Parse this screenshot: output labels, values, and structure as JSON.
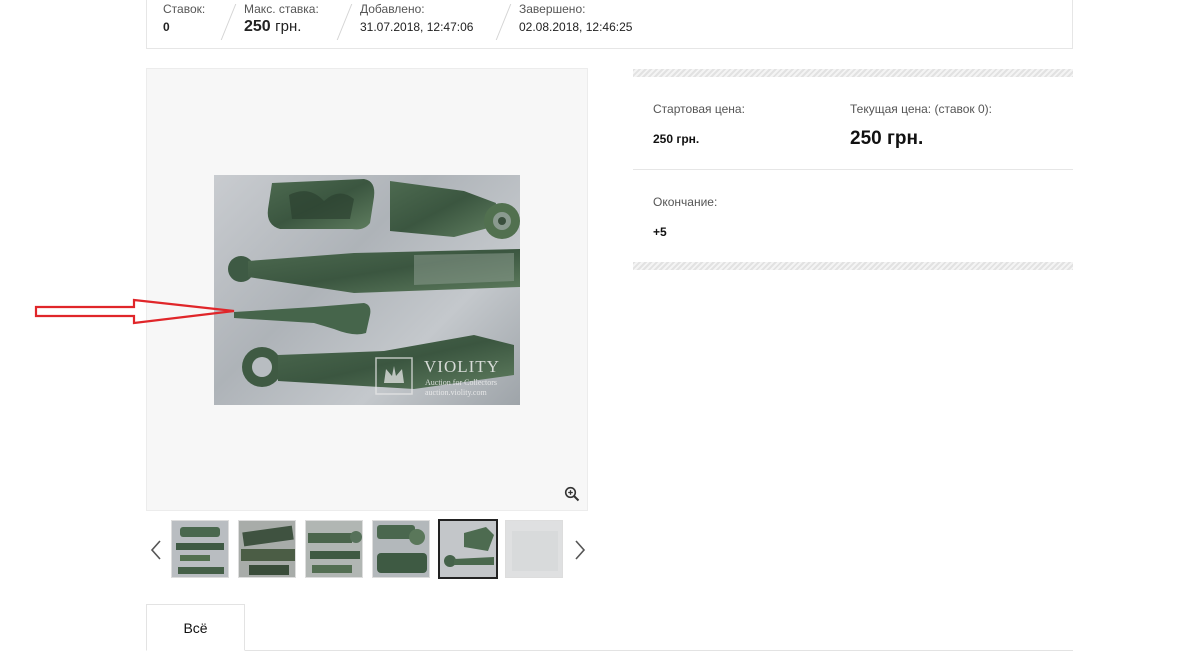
{
  "stats": {
    "bids_label": "Ставок:",
    "bids_value": "0",
    "max_bid_label": "Макс. ставка:",
    "max_bid_amount": "250",
    "max_bid_unit": "грн.",
    "added_label": "Добавлено:",
    "added_value": "31.07.2018, 12:47:06",
    "finished_label": "Завершено:",
    "finished_value": "02.08.2018, 12:46:25"
  },
  "photo": {
    "watermark_brand": "VIOLITY",
    "watermark_tagline": "Auction for Collectors",
    "watermark_url": "auction.violity.com"
  },
  "gallery": {
    "thumbnail_count": 6,
    "active_thumbnail": 5
  },
  "price": {
    "start_label": "Стартовая цена:",
    "start_value": "250 грн.",
    "current_label": "Текущая цена: (ставок 0):",
    "current_value": "250 грн.",
    "end_label": "Окончание:",
    "end_value": "+5"
  },
  "tabs": [
    {
      "label": "Всё"
    }
  ],
  "colors": {
    "annotation_arrow": "#e0262a",
    "patina_dark": "#3f5b45",
    "patina_light": "#6f8f70"
  },
  "icons": [
    "zoom-in-icon",
    "chevron-left-icon",
    "chevron-right-icon"
  ]
}
